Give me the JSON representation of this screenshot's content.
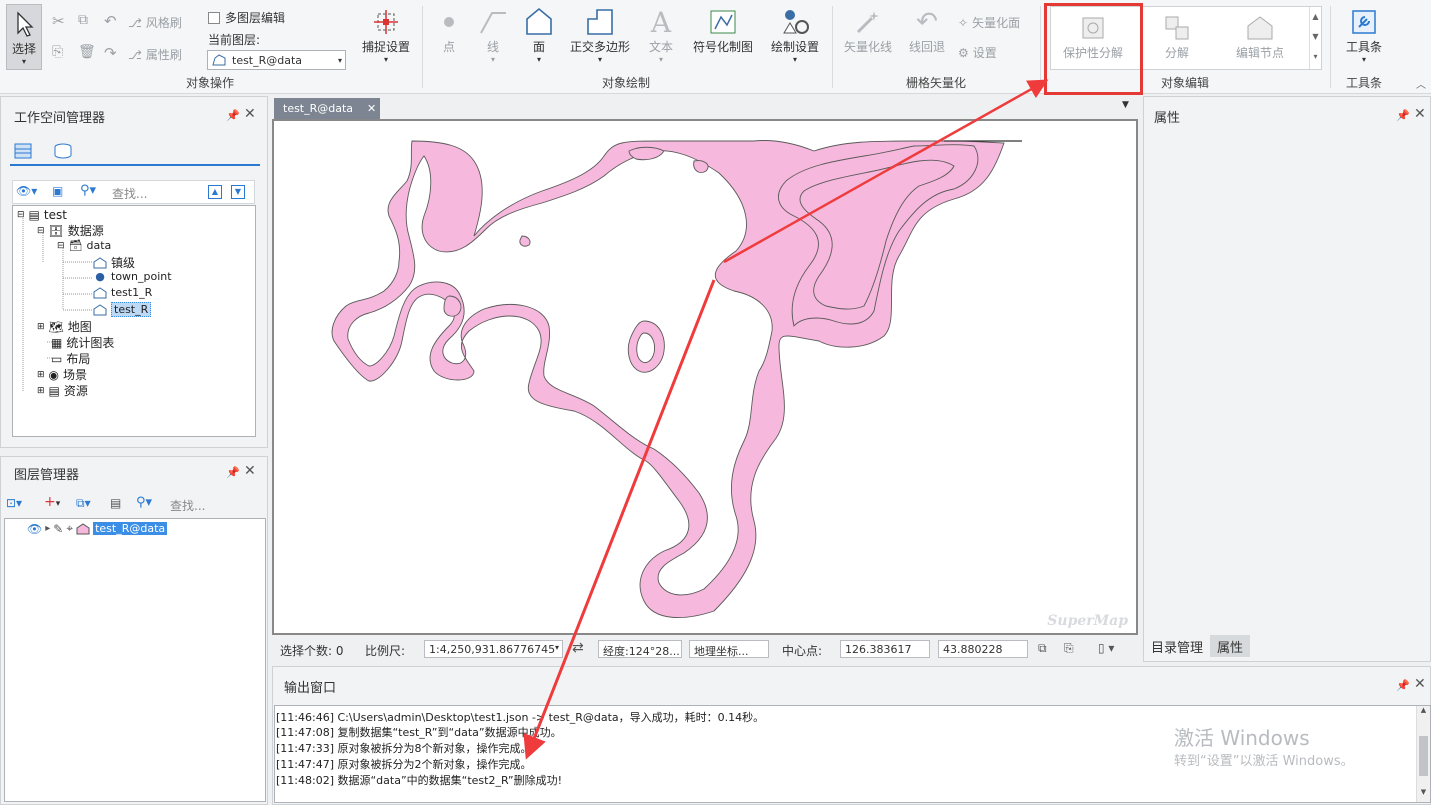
{
  "ribbon": {
    "select": "选择",
    "wind": "风格刷",
    "attr_brush": "属性刷",
    "multi_layer": "多图层编辑",
    "current_layer_label": "当前图层:",
    "current_layer_value": "test_R@data",
    "snap": "捕捉设置",
    "group_object_ops": "对象操作",
    "point": "点",
    "line": "线",
    "face": "面",
    "ortho_poly": "正交多边形",
    "text": "文本",
    "symbol_draw": "符号化制图",
    "draw_settings": "绘制设置",
    "group_object_draw": "对象绘制",
    "vec_line": "矢量化线",
    "line_back": "线回退",
    "vec_face": "矢量化面",
    "settings": "设置",
    "group_raster": "栅格矢量化",
    "protect_decompose": "保护性分解",
    "decompose": "分解",
    "edit_node": "编辑节点",
    "group_object_edit": "对象编辑",
    "toolbar": "工具条",
    "group_toolbar": "工具条"
  },
  "workspace": {
    "title": "工作空间管理器",
    "search_placeholder": "查找...",
    "tree": {
      "root": "test",
      "datasources": "数据源",
      "data": "data",
      "zhenji": "镇级",
      "town_point": "town_point",
      "test1": "test1_R",
      "test": "test_R",
      "map": "地图",
      "chart": "统计图表",
      "layout": "布局",
      "scene": "场景",
      "resource": "资源"
    }
  },
  "layers": {
    "title": "图层管理器",
    "search_placeholder": "查找...",
    "layer": "test_R@data"
  },
  "map": {
    "tab": "test_R@data",
    "watermark": "SuperMap"
  },
  "statusbar": {
    "select_count": "选择个数: 0",
    "scale_label": "比例尺:",
    "scale_value": "1:4,250,931.86776745",
    "longitude": "经度:124°28...",
    "coord": "地理坐标...",
    "center_label": "中心点:",
    "cx": "126.383617",
    "cy": "43.880228"
  },
  "properties": {
    "title": "属性",
    "tab_catalog": "目录管理",
    "tab_props": "属性"
  },
  "output": {
    "title": "输出窗口",
    "lines": [
      "[11:46:46] C:\\Users\\admin\\Desktop\\test1.json     -> test_R@data，导入成功，耗时：0.14秒。",
      "[11:47:08] 复制数据集“test_R”到“data”数据源中成功。",
      "[11:47:33] 原对象被拆分为8个新对象，操作完成。",
      "[11:47:47] 原对象被拆分为2个新对象，操作完成。",
      "[11:48:02] 数据源“data”中的数据集“test2_R”删除成功!"
    ]
  },
  "activation": {
    "title": "激活 Windows",
    "sub": "转到“设置”以激活 Windows。"
  },
  "colors": {
    "accent": "#2b79d0",
    "highlight_box": "#e53935",
    "arrow": "#ef3b3b",
    "polygon_fill": "#f6b8dc"
  }
}
